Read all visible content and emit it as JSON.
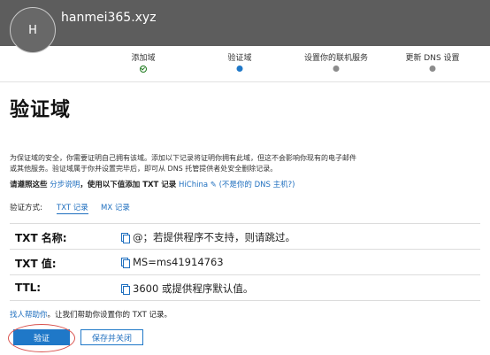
{
  "header": {
    "avatar_initial": "H",
    "domain": "hanmei365.xyz"
  },
  "steps": [
    {
      "label": "添加域",
      "status": "complete"
    },
    {
      "label": "验证域",
      "status": "current"
    },
    {
      "label": "设置你的联机服务",
      "status": "pending"
    },
    {
      "label": "更新 DNS 设置",
      "status": "pending"
    }
  ],
  "page": {
    "title": "验证域",
    "intro_line1": "为保证域的安全，你需要证明自己拥有该域。添加以下记录将证明你拥有此域，但这不会影响你现有的电子邮件",
    "intro_line2": "或其他服务。验证域属于你并设置完毕后，即可从 DNS 托管提供者处安全删除记录。",
    "instr_prefix": "请遵照这些",
    "instr_link": "分步说明",
    "instr_middle": "，使用以下值添加 TXT 记录",
    "provider": "HiChina",
    "not_your_host": "(不是你的 DNS 主机?)"
  },
  "method": {
    "label": "验证方式:",
    "tabs": [
      {
        "label": "TXT 记录",
        "active": true
      },
      {
        "label": "MX 记录",
        "active": false
      }
    ]
  },
  "records": [
    {
      "label": "TXT 名称:",
      "value": "@；若提供程序不支持，则请跳过。"
    },
    {
      "label": "TXT 值:",
      "value": "MS=ms41914763"
    },
    {
      "label": "TTL:",
      "value": "3600 或提供程序默认值。"
    }
  ],
  "help": {
    "link": "找人帮助你",
    "text": "。让我们帮助你设置你的 TXT 记录。"
  },
  "buttons": {
    "verify": "验证",
    "save_close": "保存并关闭"
  },
  "colors": {
    "header_bg": "#5d5d5d",
    "accent": "#1f78c8",
    "complete": "#1e7a1e",
    "pending": "#8c8c8c",
    "annotation": "#d9534f"
  }
}
